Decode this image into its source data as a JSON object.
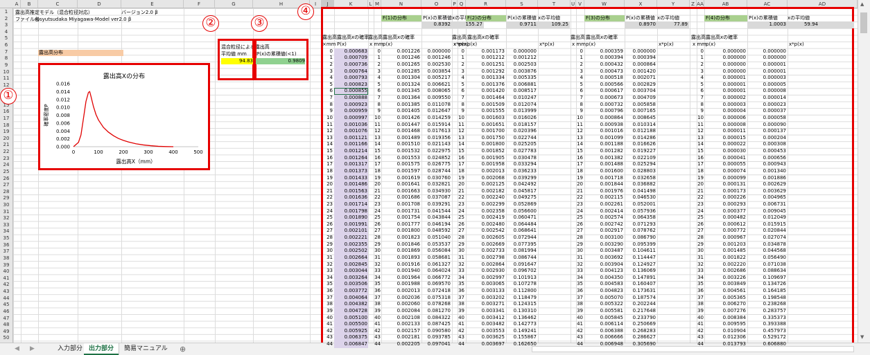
{
  "column_letters": [
    "A",
    "B",
    "C",
    "D",
    "E",
    "F",
    "G",
    "H",
    "I",
    "J",
    "K",
    "L",
    "M",
    "N",
    "O",
    "P",
    "Q",
    "R",
    "S",
    "T",
    "U",
    "V",
    "W",
    "X",
    "Y",
    "Z",
    "AA",
    "AB",
    "AC",
    "AD"
  ],
  "top_left": {
    "title": "露出高推定モデル（混合粒径対応）",
    "version": "バージョン2.0 β",
    "file_label": "ファイル名",
    "file_value": "rosyutsudaka Miyagawa-Model ver2.0 β",
    "dist_header": "露出高分布"
  },
  "chart_data": {
    "type": "line",
    "title": "露出高Xの分布",
    "xlabel": "露出高X（mm）",
    "ylabel": "確率密度P",
    "xlim": [
      0,
      500
    ],
    "ylim": [
      0,
      0.016
    ],
    "x_ticks": [
      "0",
      "100",
      "200",
      "300",
      "400",
      "500"
    ],
    "y_ticks": [
      "0.000",
      "0.002",
      "0.004",
      "0.006",
      "0.008",
      "0.010",
      "0.012",
      "0.014",
      "0.016"
    ],
    "x": [
      0,
      20,
      30,
      40,
      50,
      60,
      65,
      70,
      80,
      90,
      100,
      120,
      140,
      160,
      180,
      200,
      220,
      250,
      280,
      310,
      340,
      370,
      400
    ],
    "y": [
      0,
      0.0011,
      0.003,
      0.0072,
      0.0115,
      0.0138,
      0.014,
      0.0128,
      0.0102,
      0.0082,
      0.0068,
      0.0049,
      0.0037,
      0.0028,
      0.0021,
      0.0016,
      0.0012,
      0.00075,
      0.00045,
      0.00025,
      0.0001,
      3e-05,
      0
    ],
    "color": "#e00000"
  },
  "summary": {
    "header": "混合粒径による露出高",
    "col1": "平均値 mm",
    "col2": "P(x)の累積値(<1)",
    "mean": "94.83",
    "cum": "0.9809",
    "yellow": "#ffff00",
    "green": "#8fd18f"
  },
  "numbers": [
    "①",
    "②",
    "③",
    "④"
  ],
  "main": {
    "xh1": "露出高",
    "xh2": "×mm",
    "jh1": "露出高xの確率",
    "jh2": "P(x)",
    "x": [
      "0",
      "1",
      "2",
      "3",
      "4",
      "5",
      "6",
      "7",
      "8",
      "9",
      "10",
      "11",
      "12",
      "13",
      "14",
      "15",
      "16",
      "17",
      "18",
      "19",
      "20",
      "21",
      "22",
      "23",
      "24",
      "25",
      "26",
      "27",
      "28",
      "29",
      "30",
      "31",
      "32",
      "33",
      "34",
      "35",
      "36",
      "37",
      "38",
      "39",
      "40",
      "41",
      "42",
      "43",
      "44"
    ],
    "px": [
      "0.000683",
      "0.000709",
      "0.000736",
      "0.000764",
      "0.000793",
      "0.000823",
      "0.000855",
      "0.000888",
      "0.000923",
      "0.000959",
      "0.000997",
      "0.001036",
      "0.001076",
      "0.001121",
      "0.001166",
      "0.001214",
      "0.001264",
      "0.001317",
      "0.001373",
      "0.001433",
      "0.001486",
      "0.001563",
      "0.001636",
      "0.001714",
      "0.001798",
      "0.001890",
      "0.001991",
      "0.002101",
      "0.002221",
      "0.002355",
      "0.002502",
      "0.002664",
      "0.002845",
      "0.003044",
      "0.003264",
      "0.003506",
      "0.003772",
      "0.004064",
      "0.004382",
      "0.004728",
      "0.005100",
      "0.005500",
      "0.005925",
      "0.006375",
      "0.006847"
    ]
  },
  "groups": [
    {
      "label": "F(1)の分布",
      "sum_hdr": "P(x)の累積値",
      "mean_hdr": "xの平均値",
      "sum": "0.8392",
      "mean": "155.27",
      "sh1": "露出高",
      "sh2": "x mm",
      "h1": "露出高xの確率",
      "h3": "p(x)",
      "h4": "x*p(x)",
      "p": [
        "0.001226",
        "0.001246",
        "0.001265",
        "0.001285",
        "0.001304",
        "0.001324",
        "0.001345",
        "0.001364",
        "0.001385",
        "0.001405",
        "0.001426",
        "0.001447",
        "0.001468",
        "0.001489",
        "0.001510",
        "0.001532",
        "0.001553",
        "0.001575",
        "0.001597",
        "0.001619",
        "0.001641",
        "0.001663",
        "0.001686",
        "0.001708",
        "0.001731",
        "0.001754",
        "0.001777",
        "0.001800",
        "0.001823",
        "0.001846",
        "0.001869",
        "0.001893",
        "0.001916",
        "0.001940",
        "0.001964",
        "0.001988",
        "0.002013",
        "0.002036",
        "0.002060",
        "0.002084",
        "0.002108",
        "0.002133",
        "0.002157",
        "0.002181",
        "0.002205"
      ],
      "xp": [
        "0.000000",
        "0.001246",
        "0.002530",
        "0.003854",
        "0.005217",
        "0.006621",
        "0.008065",
        "0.009550",
        "0.011078",
        "0.012647",
        "0.014259",
        "0.015914",
        "0.017613",
        "0.019356",
        "0.021143",
        "0.022975",
        "0.024852",
        "0.026775",
        "0.028744",
        "0.030760",
        "0.032821",
        "0.034930",
        "0.037087",
        "0.039291",
        "0.041544",
        "0.043844",
        "0.046194",
        "0.048592",
        "0.051040",
        "0.053537",
        "0.056084",
        "0.058681",
        "0.061327",
        "0.064024",
        "0.066772",
        "0.069570",
        "0.072418",
        "0.075318",
        "0.078268",
        "0.081270",
        "0.084322",
        "0.087425",
        "0.090580",
        "0.093785",
        "0.097041"
      ]
    },
    {
      "label": "F(2)の分布",
      "sum_hdr": "P(x)の累積値",
      "mean_hdr": "xの平均値",
      "sum": "0.9711",
      "mean": "109.25",
      "sh1": "露出高",
      "sh2": "x mm",
      "h1": "露出高xの確率",
      "h3": "p(x)",
      "h4": "x*p(x)",
      "p": [
        "0.001173",
        "0.001212",
        "0.001251",
        "0.001292",
        "0.001334",
        "0.001376",
        "0.001420",
        "0.001464",
        "0.001509",
        "0.001555",
        "0.001603",
        "0.001651",
        "0.001700",
        "0.001750",
        "0.001800",
        "0.001852",
        "0.001905",
        "0.001958",
        "0.002013",
        "0.002068",
        "0.002125",
        "0.002182",
        "0.002240",
        "0.002299",
        "0.002358",
        "0.002419",
        "0.002480",
        "0.002542",
        "0.002605",
        "0.002669",
        "0.002733",
        "0.002798",
        "0.002864",
        "0.002930",
        "0.002997",
        "0.003065",
        "0.003133",
        "0.003202",
        "0.003271",
        "0.003341",
        "0.003412",
        "0.003482",
        "0.003553",
        "0.003625",
        "0.003697"
      ],
      "xp": [
        "0.000000",
        "0.001212",
        "0.002503",
        "0.003876",
        "0.005335",
        "0.006881",
        "0.008517",
        "0.010247",
        "0.012074",
        "0.013999",
        "0.016026",
        "0.018157",
        "0.020396",
        "0.022744",
        "0.025205",
        "0.027783",
        "0.030478",
        "0.033294",
        "0.036233",
        "0.039299",
        "0.042492",
        "0.045817",
        "0.049275",
        "0.052869",
        "0.056600",
        "0.060471",
        "0.064484",
        "0.068641",
        "0.072944",
        "0.077395",
        "0.081994",
        "0.086744",
        "0.091647",
        "0.096702",
        "0.101913",
        "0.107278",
        "0.112800",
        "0.118479",
        "0.124315",
        "0.130310",
        "0.136462",
        "0.142773",
        "0.149241",
        "0.155867",
        "0.162650"
      ]
    },
    {
      "label": "F(3)の分布",
      "sum_hdr": "P(x)の累積値",
      "mean_hdr": "xの平均値",
      "sum": "0.8970",
      "mean": "77.89",
      "sh1": "露出高",
      "sh2": "x mm",
      "h1": "露出高xの確率",
      "h3": "p(x)",
      "h4": "x*p(x)",
      "p": [
        "0.000359",
        "0.000394",
        "0.000432",
        "0.000473",
        "0.000518",
        "0.000566",
        "0.000617",
        "0.000673",
        "0.000732",
        "0.000796",
        "0.000864",
        "0.000938",
        "0.001016",
        "0.001099",
        "0.001188",
        "0.001282",
        "0.001382",
        "0.001488",
        "0.001600",
        "0.001718",
        "0.001844",
        "0.001976",
        "0.002115",
        "0.002261",
        "0.002414",
        "0.002574",
        "0.002742",
        "0.002917",
        "0.003100",
        "0.003290",
        "0.003487",
        "0.003692",
        "0.003904",
        "0.004123",
        "0.004350",
        "0.004583",
        "0.004823",
        "0.005070",
        "0.005322",
        "0.005581",
        "0.005845",
        "0.006114",
        "0.006388",
        "0.006666",
        "0.006948"
      ],
      "xp": [
        "0.000000",
        "0.000394",
        "0.000864",
        "0.001420",
        "0.002071",
        "0.002829",
        "0.003704",
        "0.004709",
        "0.005858",
        "0.007165",
        "0.008645",
        "0.010314",
        "0.012188",
        "0.014286",
        "0.016626",
        "0.019227",
        "0.022109",
        "0.025294",
        "0.028803",
        "0.032658",
        "0.036882",
        "0.041498",
        "0.046530",
        "0.052001",
        "0.057936",
        "0.064358",
        "0.071293",
        "0.078762",
        "0.086790",
        "0.095399",
        "0.104611",
        "0.114447",
        "0.124927",
        "0.136069",
        "0.147891",
        "0.160407",
        "0.173631",
        "0.187574",
        "0.202244",
        "0.217648",
        "0.233790",
        "0.250669",
        "0.268283",
        "0.286627",
        "0.305690"
      ]
    },
    {
      "label": "F(4)の分布",
      "sum_hdr": "P(x)の累積値",
      "mean_hdr": "xの平均値",
      "sum": "1.0003",
      "mean": "59.94",
      "sh1": "露出高",
      "sh2": "x mm",
      "h1": "露出高xの確率",
      "h3": "p(x)",
      "h4": "x*p(x)",
      "p": [
        "0.000000",
        "0.000000",
        "0.000000",
        "0.000000",
        "0.000001",
        "0.000001",
        "0.000001",
        "0.000002",
        "0.000003",
        "0.000004",
        "0.000006",
        "0.000008",
        "0.000011",
        "0.000015",
        "0.000022",
        "0.000030",
        "0.000041",
        "0.000055",
        "0.000074",
        "0.000099",
        "0.000131",
        "0.000173",
        "0.000226",
        "0.000293",
        "0.000377",
        "0.000482",
        "0.000612",
        "0.000772",
        "0.000967",
        "0.001203",
        "0.001485",
        "0.001822",
        "0.002220",
        "0.002686",
        "0.003226",
        "0.003849",
        "0.004561",
        "0.005365",
        "0.006270",
        "0.007276",
        "0.008384",
        "0.009595",
        "0.010904",
        "0.012306",
        "0.013793"
      ],
      "xp": [
        "0.000000",
        "0.000000",
        "0.000001",
        "0.000001",
        "0.000003",
        "0.000005",
        "0.000008",
        "0.000014",
        "0.000023",
        "0.000037",
        "0.000058",
        "0.000090",
        "0.000137",
        "0.000204",
        "0.000308",
        "0.000453",
        "0.000656",
        "0.000943",
        "0.001340",
        "0.001886",
        "0.002629",
        "0.003629",
        "0.004965",
        "0.006731",
        "0.009045",
        "0.012049",
        "0.015915",
        "0.020844",
        "0.027074",
        "0.034878",
        "0.044568",
        "0.056490",
        "0.071038",
        "0.088634",
        "0.109697",
        "0.134726",
        "0.164185",
        "0.198548",
        "0.238268",
        "0.283757",
        "0.335373",
        "0.393388",
        "0.457973",
        "0.529172",
        "0.606880"
      ]
    }
  ],
  "sheet_tabs": [
    "入力部分",
    "出力部分",
    "簡易マニュアル"
  ],
  "add_sheet": "⊕",
  "nav_left": "◀",
  "nav_right": "▶",
  "scroll_up": "▲",
  "scroll_down": "▼"
}
